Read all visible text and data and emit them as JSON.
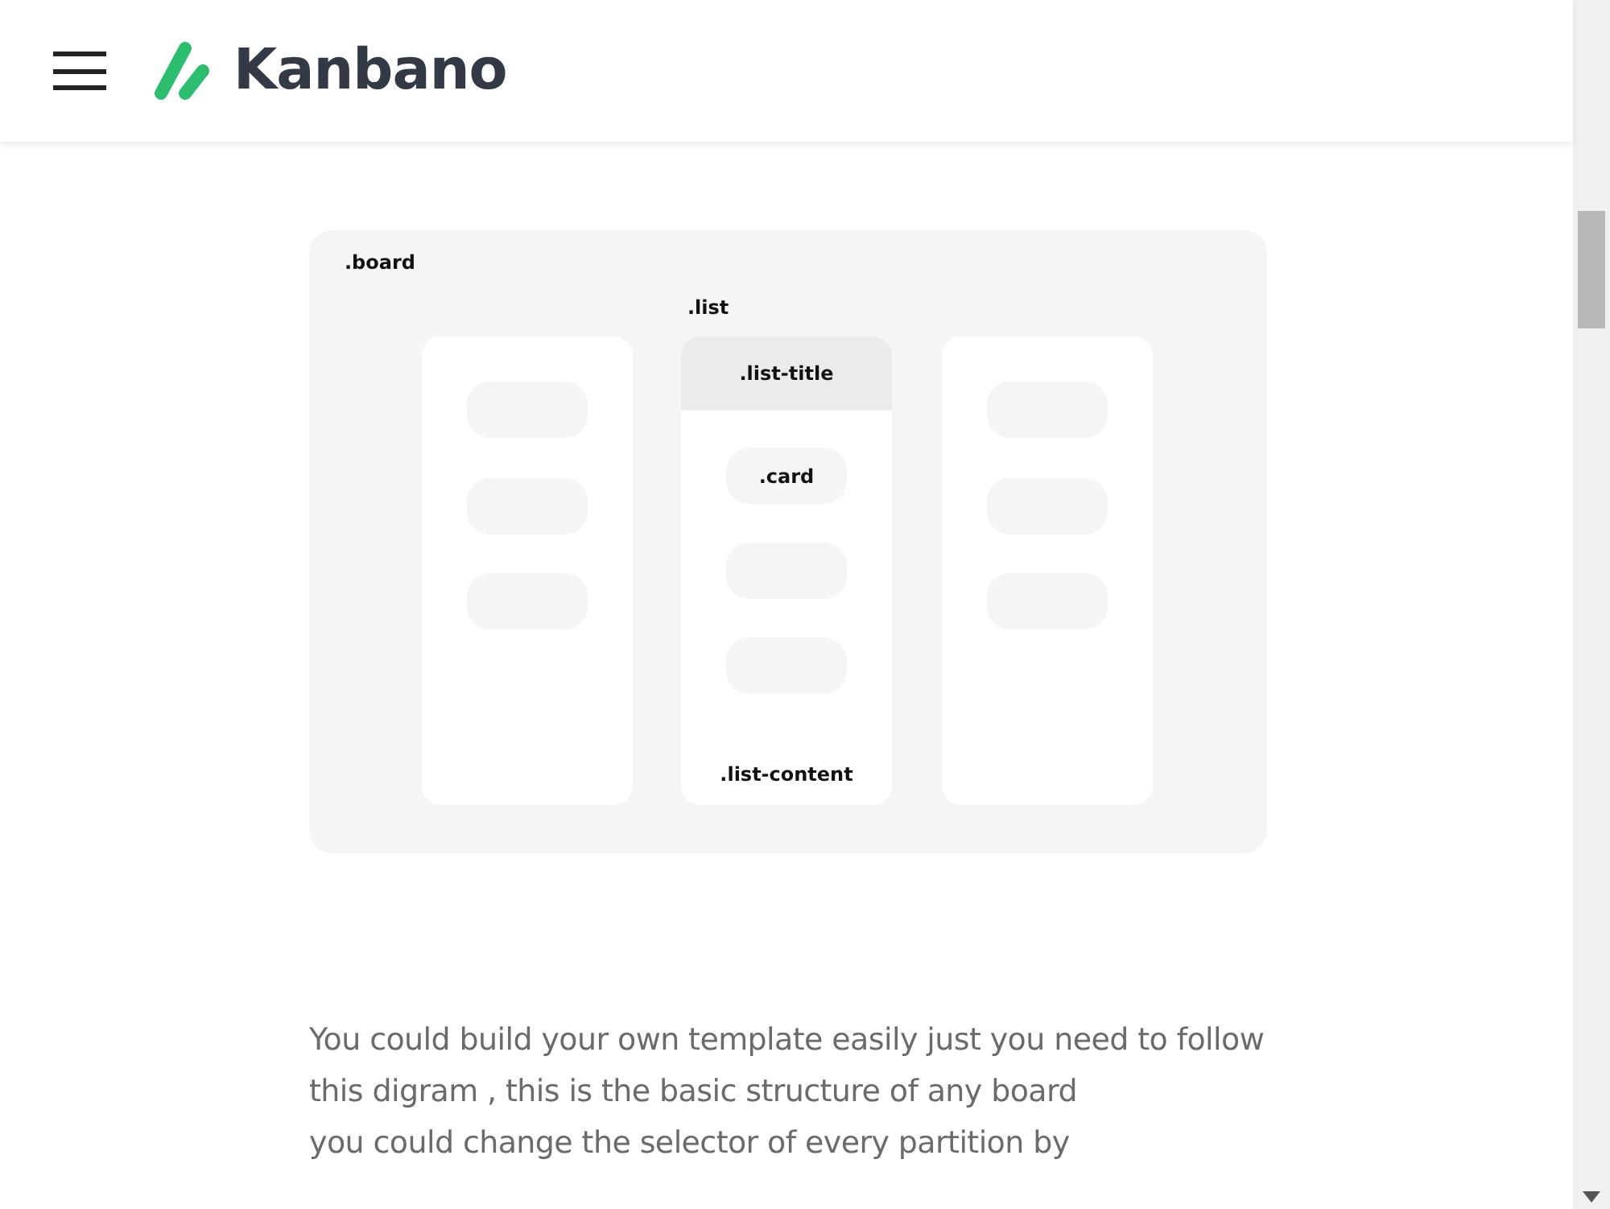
{
  "header": {
    "logo_text": "Kanbano"
  },
  "diagram": {
    "board_label": ".board",
    "list_label": ".list",
    "lists": [
      {
        "kind": "plain",
        "cards": [
          {
            "kind": "blank"
          },
          {
            "kind": "blank"
          },
          {
            "kind": "blank"
          }
        ]
      },
      {
        "kind": "detailed",
        "title": ".list-title",
        "content_label": ".list-content",
        "cards": [
          {
            "kind": "labeled",
            "label": ".card"
          },
          {
            "kind": "blank"
          },
          {
            "kind": "blank"
          }
        ]
      },
      {
        "kind": "plain",
        "cards": [
          {
            "kind": "blank"
          },
          {
            "kind": "blank"
          },
          {
            "kind": "blank"
          }
        ]
      }
    ]
  },
  "description": "You could build your own template easily just you need to follow this digram , this is the basic structure of any board\nyou could change the selector of every partition by"
}
